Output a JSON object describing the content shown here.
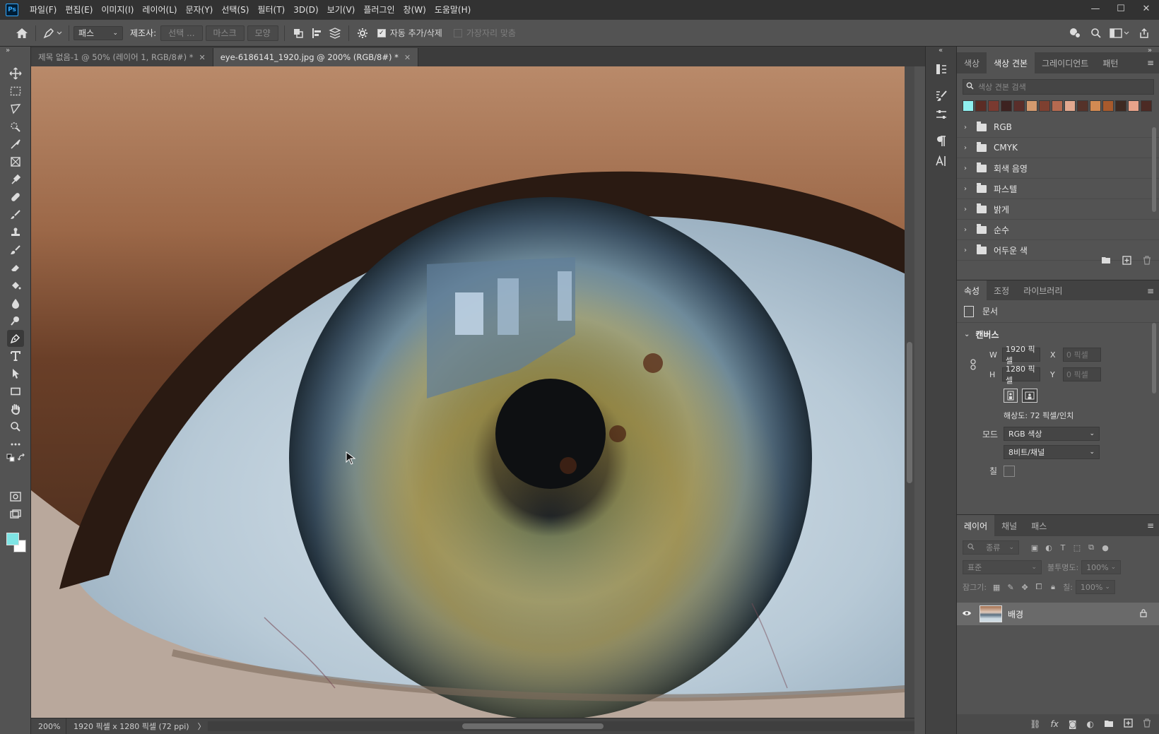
{
  "app": {
    "logo": "Ps"
  },
  "menu": {
    "items": [
      "파일(F)",
      "편집(E)",
      "이미지(I)",
      "레이어(L)",
      "문자(Y)",
      "선택(S)",
      "필터(T)",
      "3D(D)",
      "보기(V)",
      "플러그인",
      "창(W)",
      "도움말(H)"
    ]
  },
  "window": {
    "minimize": "—",
    "maximize": "☐",
    "close": "✕"
  },
  "options": {
    "mode_select": "패스",
    "make_label": "제조사:",
    "btn_selection": "선택 ...",
    "btn_mask": "마스크",
    "btn_shape": "모양",
    "auto_add_delete": "자동 추가/삭제",
    "auto_add_delete_checked": true,
    "align_edges": "가장자리 맞춤",
    "align_edges_checked": false
  },
  "tabs": [
    {
      "label": "제목 없음-1 @ 50% (레이어 1, RGB/8#) *",
      "active": false
    },
    {
      "label": "eye-6186141_1920.jpg @ 200% (RGB/8#) *",
      "active": true
    }
  ],
  "status": {
    "zoom": "200%",
    "info": "1920 픽셀 x 1280 픽셀 (72 ppi)",
    "arrow": "〉"
  },
  "colors": {
    "foreground": "#7fe5e5",
    "background": "#ffffff"
  },
  "swatches_panel": {
    "tabs": [
      "색상",
      "색상 견본",
      "그레이디언트",
      "패턴"
    ],
    "active_tab": 1,
    "search_placeholder": "색상 견본 검색",
    "swatch_colors": [
      "#8ff0f0",
      "#5b2c24",
      "#7a3a30",
      "#3d2220",
      "#5a2e2a",
      "#d49a6e",
      "#7e4030",
      "#b56a50",
      "#e3a88f",
      "#553229",
      "#d28a52",
      "#a85a2c",
      "#3e2a22",
      "#e9a38a",
      "#4c2a24"
    ],
    "groups": [
      "RGB",
      "CMYK",
      "회색 음영",
      "파스텔",
      "밝게",
      "순수",
      "어두운 색"
    ]
  },
  "properties_panel": {
    "tabs": [
      "속성",
      "조정",
      "라이브러리"
    ],
    "active_tab": 0,
    "doc_label": "문서",
    "section": "캔버스",
    "w_label": "W",
    "w_value": "1920 픽셀",
    "h_label": "H",
    "h_value": "1280 픽셀",
    "x_label": "X",
    "x_value": "0 픽셀",
    "y_label": "Y",
    "y_value": "0 픽셀",
    "resolution": "해상도: 72 픽셀/인치",
    "mode_label": "모드",
    "mode_value": "RGB 색상",
    "bit_value": "8비트/채널",
    "fill_label": "칠"
  },
  "layers_panel": {
    "tabs": [
      "레이어",
      "채널",
      "패스"
    ],
    "active_tab": 0,
    "kind_placeholder": "종류",
    "blend_mode": "표준",
    "opacity_label": "불투명도:",
    "opacity_value": "100%",
    "lock_label": "잠그기:",
    "fill_label": "칠:",
    "fill_value": "100%",
    "layer_name": "배경"
  }
}
